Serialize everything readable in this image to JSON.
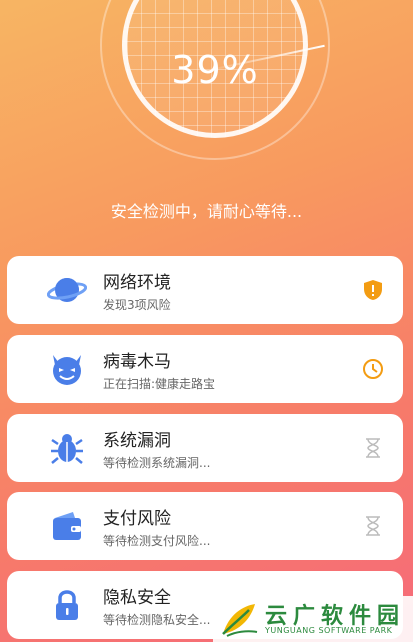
{
  "scan": {
    "progress_text": "39%",
    "progress_value": 0.39,
    "status_text": "安全检测中，请耐心等待..."
  },
  "checks": [
    {
      "title": "网络环境",
      "subtitle": "发现3项风险",
      "icon": "planet-icon",
      "state": "warning-shield-icon",
      "state_color": "#f39c12"
    },
    {
      "title": "病毒木马",
      "subtitle": "正在扫描:健康走路宝",
      "icon": "devil-icon",
      "state": "clock-icon",
      "state_color": "#f39c12"
    },
    {
      "title": "系统漏洞",
      "subtitle": "等待检测系统漏洞...",
      "icon": "bug-icon",
      "state": "hourglass-icon",
      "state_color": "#bbbbbb"
    },
    {
      "title": "支付风险",
      "subtitle": "等待检测支付风险...",
      "icon": "wallet-icon",
      "state": "hourglass-icon",
      "state_color": "#bbbbbb"
    },
    {
      "title": "隐私安全",
      "subtitle": "等待检测隐私安全...",
      "icon": "lock-icon",
      "state": "hourglass-icon",
      "state_color": "#bbbbbb"
    }
  ],
  "colors": {
    "accent_blue": "#4a7ee8",
    "warning": "#f39c12"
  },
  "watermark": {
    "cn": "云广软件园",
    "en": "YUNGUANG SOFTWARE PARK"
  }
}
